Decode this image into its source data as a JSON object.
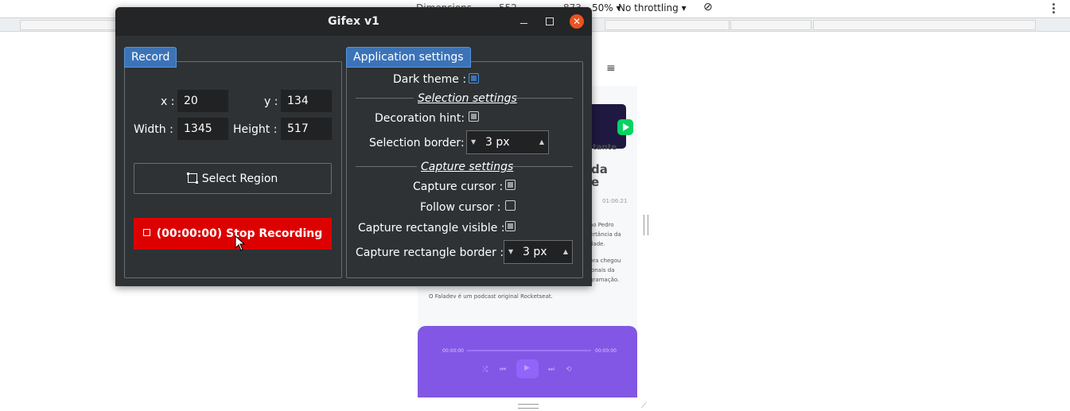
{
  "devtools": {
    "throttling": "No throttling",
    "zoom": "50%",
    "width_value": "552",
    "height_value": "873",
    "device_label": "Dimensions"
  },
  "preview": {
    "menu_icon": "≡",
    "badge_text": "tante",
    "heading_line1": "da",
    "heading_line2": "e",
    "duration": "01:06:21",
    "desc_1a": "ão Pedro",
    "desc_1b": "ertância da",
    "desc_1c": "dade.",
    "desc_2a": "ora chegou",
    "desc_2b": "ionais da",
    "desc_2c": "gramação.",
    "footer": "O Faladev é um podcast original Rocketseat.",
    "time_start": "00:00:00",
    "time_end": "00:00:00"
  },
  "window": {
    "title": "Gifex v1",
    "close_glyph": "✕"
  },
  "record": {
    "tab_label": "Record",
    "x_label": "x :",
    "x_value": "20",
    "y_label": "y :",
    "y_value": "134",
    "width_label": "Width :",
    "width_value": "1345",
    "height_label": "Height :",
    "height_value": "517",
    "select_region_label": "Select Region",
    "stop_label": "(00:00:00) Stop Recording"
  },
  "settings": {
    "tab_label": "Application settings",
    "dark_theme_label": "Dark theme :",
    "dark_theme_checked": true,
    "selection_section": "Selection settings",
    "decoration_hint_label": "Decoration hint:",
    "selection_border_label": "Selection border:",
    "selection_border_value": "3 px",
    "capture_section": "Capture settings",
    "capture_cursor_label": "Capture cursor :",
    "follow_cursor_label": "Follow cursor :",
    "capture_rect_visible_label": "Capture rectangle visible :",
    "capture_rect_border_label": "Capture rectangle border :",
    "capture_rect_border_value": "3 px"
  },
  "colors": {
    "window_bg": "#2e3235",
    "accent": "#3b73b9",
    "stop_red": "#dd0000",
    "close_orange": "#e95420",
    "player_purple": "#8257e5",
    "play_green": "#04d361"
  }
}
